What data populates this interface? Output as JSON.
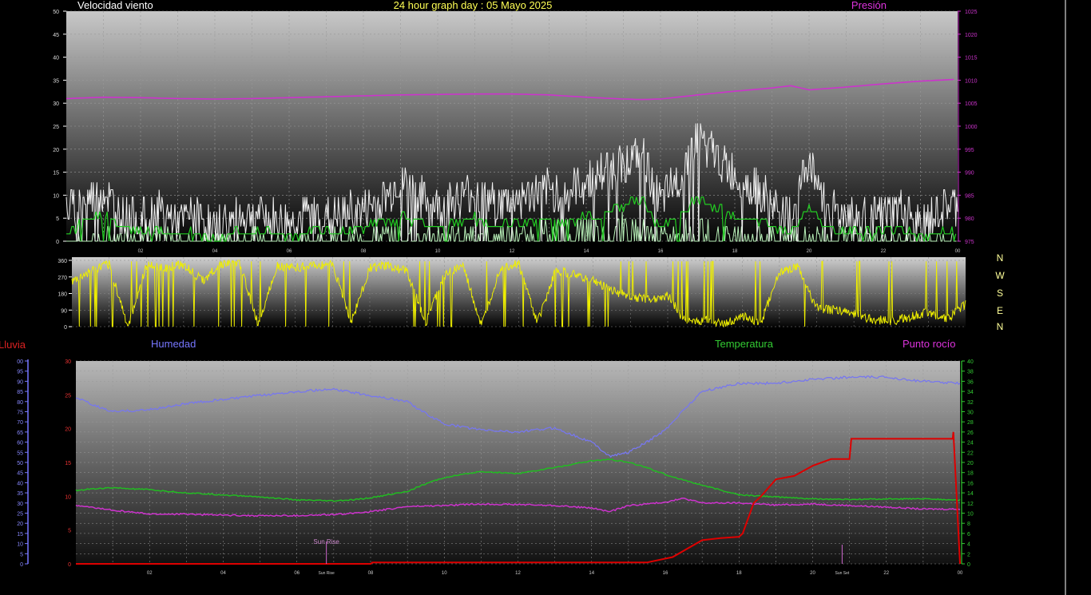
{
  "header": {
    "left": "Velocidad viento",
    "center": "24 hour graph day : 05 Mayo 2025",
    "right": "Presión"
  },
  "lower_header": {
    "rain": "Lluvia",
    "humidity": "Humedad",
    "temperature": "Temperatura",
    "dewpoint": "Punto rocío"
  },
  "compass": [
    "N",
    "W",
    "S",
    "E",
    "N"
  ],
  "annotations": {
    "sunrise": "Sun Rise",
    "sunset": "Sun Set"
  },
  "colors": {
    "gust": "#f0f0f0",
    "wind_avg": "#22cc22",
    "wind_low": "#b8f0b8",
    "pressure": "#cc33cc",
    "direction": "#eeee00",
    "humidity": "#7777ee",
    "temperature": "#22bb22",
    "dewpoint": "#cc33cc",
    "rain": "#dd0000",
    "header_white": "#ffffff",
    "header_rain": "#dd2222",
    "header_humidity": "#7777ff",
    "header_temp": "#33cc33",
    "header_dew": "#dd33dd",
    "compass": "#ffff99"
  },
  "chart_data": [
    {
      "type": "line",
      "id": "wind",
      "x_ticks": [
        "02",
        "04",
        "06",
        "08",
        "10",
        "12",
        "14",
        "16",
        "18",
        "20",
        "22",
        "00"
      ],
      "y_left_ticks": [
        "0",
        "5",
        "10",
        "15",
        "20",
        "25",
        "30",
        "35",
        "40",
        "45",
        "50"
      ],
      "y_right_ticks": [
        "975",
        "980",
        "985",
        "990",
        "995",
        "1000",
        "1005",
        "1010",
        "1015",
        "1020",
        "1025"
      ],
      "ylim_left": [
        0,
        50
      ],
      "ylim_right": [
        975,
        1025
      ],
      "series": [
        {
          "key": "gust",
          "x": [
            0,
            0.5,
            1,
            1.5,
            2,
            2.5,
            3,
            3.5,
            4,
            4.5,
            5,
            5.5,
            6,
            6.5,
            7,
            7.5,
            8,
            8.5,
            9,
            9.5,
            10,
            10.5,
            11,
            11.5,
            12,
            12.5,
            13,
            13.5,
            14,
            14.5,
            15,
            15.5,
            16,
            16.5,
            17,
            17.5,
            18,
            18.5,
            19,
            19.5,
            20,
            20.5,
            21,
            21.5,
            22,
            22.5,
            23,
            23.5,
            24
          ],
          "y": [
            7,
            9,
            11,
            6,
            5,
            7,
            4,
            6,
            3,
            5,
            6,
            5,
            4,
            6,
            5,
            6,
            7,
            9,
            13,
            10,
            7,
            9,
            11,
            8,
            9,
            10,
            11,
            10,
            13,
            15,
            17,
            19,
            8,
            14,
            23,
            18,
            14,
            12,
            8,
            5,
            18,
            7,
            6,
            5,
            6,
            7,
            4,
            6,
            8
          ]
        },
        {
          "key": "wind_avg",
          "x": [
            0,
            0.5,
            1,
            1.5,
            2,
            2.5,
            3,
            3.5,
            4,
            4.5,
            5,
            5.5,
            6,
            6.5,
            7,
            7.5,
            8,
            8.5,
            9,
            9.5,
            10,
            10.5,
            11,
            11.5,
            12,
            12.5,
            13,
            13.5,
            14,
            14.5,
            15,
            15.5,
            16,
            16.5,
            17,
            17.5,
            18,
            18.5,
            19,
            19.5,
            20,
            20.5,
            21,
            21.5,
            22,
            22.5,
            23,
            23.5,
            24
          ],
          "y": [
            2,
            4,
            6,
            3,
            2,
            3,
            1,
            2,
            1,
            2,
            2,
            2,
            1,
            2,
            2,
            2,
            3,
            4,
            5,
            4,
            3,
            4,
            5,
            3,
            4,
            4,
            5,
            4,
            5,
            6,
            8,
            9,
            3,
            6,
            9,
            7,
            5,
            5,
            3,
            2,
            7,
            3,
            2,
            2,
            2,
            3,
            1,
            2,
            3
          ]
        },
        {
          "key": "wind_low",
          "x": [
            0,
            1,
            2,
            3,
            4,
            5,
            6,
            7,
            8,
            9,
            10,
            11,
            12,
            13,
            14,
            15,
            16,
            17,
            18,
            19,
            20,
            21,
            22,
            23,
            24
          ],
          "y": [
            0,
            1,
            2,
            0,
            0,
            1,
            0,
            1,
            1,
            2,
            1,
            2,
            2,
            2,
            3,
            4,
            1,
            3,
            2,
            1,
            2,
            1,
            1,
            0,
            1
          ]
        },
        {
          "key": "pressure",
          "axis": "right",
          "x": [
            0,
            1,
            2,
            3,
            4,
            5,
            6,
            7,
            8,
            9,
            10,
            11,
            12,
            13,
            14,
            15,
            15.5,
            16,
            17,
            18,
            19,
            19.5,
            20,
            21,
            22,
            23,
            24
          ],
          "y": [
            1006,
            1006.3,
            1006.2,
            1006,
            1005.9,
            1006,
            1006.2,
            1006.4,
            1006.6,
            1006.8,
            1006.9,
            1007,
            1007,
            1006.8,
            1006.3,
            1005.9,
            1005.8,
            1005.9,
            1006.8,
            1007.6,
            1008.3,
            1008.8,
            1007.9,
            1008.5,
            1009.2,
            1009.8,
            1010.2
          ]
        }
      ]
    },
    {
      "type": "line",
      "id": "direction",
      "x_ticks": [],
      "y_ticks": [
        "0",
        "90",
        "180",
        "270",
        "360"
      ],
      "ylim": [
        0,
        360
      ],
      "series": [
        {
          "key": "direction",
          "x": [
            0,
            0.5,
            1,
            1.5,
            2,
            2.5,
            3,
            3.5,
            4,
            4.5,
            5,
            5.5,
            6,
            6.5,
            7,
            7.5,
            8,
            8.5,
            9,
            9.5,
            10,
            10.5,
            11,
            11.5,
            12,
            12.5,
            13,
            13.5,
            14,
            14.5,
            15,
            15.5,
            16,
            16.5,
            17,
            17.5,
            18,
            18.5,
            19,
            19.5,
            20,
            20.5,
            21,
            21.5,
            22,
            22.5,
            23,
            23.5,
            24
          ],
          "y": [
            240,
            300,
            340,
            0,
            330,
            320,
            340,
            250,
            340,
            350,
            10,
            330,
            320,
            330,
            340,
            20,
            320,
            330,
            300,
            20,
            280,
            330,
            0,
            320,
            340,
            20,
            310,
            280,
            250,
            200,
            160,
            150,
            170,
            20,
            40,
            10,
            60,
            20,
            300,
            320,
            100,
            90,
            70,
            40,
            30,
            50,
            80,
            40,
            120
          ]
        }
      ]
    },
    {
      "type": "line",
      "id": "temp",
      "x_ticks": [
        "02",
        "04",
        "06",
        "08",
        "10",
        "12",
        "14",
        "16",
        "18",
        "20",
        "22",
        "00"
      ],
      "y_hum_ticks": [
        "0",
        "5",
        "10",
        "15",
        "20",
        "25",
        "30",
        "35",
        "40",
        "45",
        "50",
        "55",
        "60",
        "65",
        "70",
        "75",
        "80",
        "85",
        "90",
        "95",
        "00"
      ],
      "y_rain_ticks": [
        "0",
        "5",
        "10",
        "15",
        "20",
        "25",
        "30"
      ],
      "y_temp_ticks": [
        "0",
        "2",
        "4",
        "6",
        "8",
        "10",
        "12",
        "14",
        "16",
        "18",
        "20",
        "22",
        "24",
        "26",
        "28",
        "30",
        "32",
        "34",
        "36",
        "38",
        "40"
      ],
      "ylim_hum": [
        0,
        100
      ],
      "ylim_rain": [
        0,
        30
      ],
      "ylim_temp": [
        0,
        40
      ],
      "series": [
        {
          "key": "humidity",
          "axis": "hum",
          "x": [
            0,
            0.5,
            1,
            2,
            3,
            4,
            5,
            6,
            7,
            8,
            9,
            9.5,
            10,
            11,
            12,
            13,
            14,
            14.5,
            15,
            15.5,
            16,
            16.5,
            17,
            18,
            19,
            20,
            21,
            22,
            23,
            24
          ],
          "y": [
            82,
            78,
            75,
            76,
            79,
            81,
            83,
            85,
            86,
            83,
            80,
            74,
            69,
            66,
            65,
            67,
            60,
            53,
            55,
            60,
            66,
            76,
            85,
            89,
            89,
            91,
            92,
            92,
            90,
            89
          ]
        },
        {
          "key": "temperature",
          "axis": "temp",
          "x": [
            0,
            0.5,
            1,
            2,
            3,
            4,
            5,
            6,
            7,
            7.5,
            8,
            9,
            9.5,
            10,
            11,
            12,
            13,
            14,
            14.5,
            15,
            15.5,
            16,
            17,
            18,
            19,
            20,
            21,
            22,
            23,
            24
          ],
          "y": [
            14.5,
            14.8,
            15,
            14.6,
            14,
            13.6,
            13.2,
            12.6,
            12.4,
            12.6,
            13,
            14.3,
            15.8,
            17,
            18.2,
            17.8,
            19,
            20.3,
            20.6,
            20,
            19,
            17.6,
            15.5,
            13.6,
            13.2,
            12.8,
            12.7,
            12.8,
            12.8,
            12.6
          ]
        },
        {
          "key": "dewpoint",
          "axis": "temp",
          "x": [
            0,
            1,
            2,
            3,
            4,
            5,
            6,
            7,
            8,
            9,
            10,
            11,
            12,
            13,
            14,
            14.5,
            15,
            15.5,
            16,
            16.5,
            17,
            18,
            19,
            20,
            21,
            22,
            23,
            24
          ],
          "y": [
            11.5,
            10.6,
            9.8,
            9.8,
            9.6,
            9.5,
            9.5,
            9.7,
            10.3,
            11.3,
            11.5,
            11.8,
            11.7,
            11.5,
            11,
            10.3,
            11.5,
            11.8,
            12.2,
            12.9,
            12,
            12,
            11.6,
            11.8,
            11.5,
            11.2,
            10.8,
            10.8
          ]
        },
        {
          "key": "rain",
          "axis": "rain",
          "x": [
            0,
            8,
            8.05,
            12,
            15.5,
            16.2,
            17,
            17.5,
            18,
            18.1,
            18.4,
            18.6,
            19,
            19.5,
            20,
            20.5,
            21,
            21.05,
            22,
            23,
            23.8,
            23.82,
            24
          ],
          "y": [
            0,
            0,
            0.2,
            0.2,
            0.2,
            1,
            3.5,
            3.8,
            4,
            4.5,
            9,
            10,
            12.5,
            13,
            14.5,
            15.5,
            15.5,
            18.5,
            18.5,
            18.5,
            18.5,
            19.5,
            0
          ]
        }
      ],
      "markers": [
        {
          "key": "sunrise",
          "x": 6.8
        },
        {
          "key": "sunset",
          "x": 20.8
        }
      ]
    }
  ]
}
